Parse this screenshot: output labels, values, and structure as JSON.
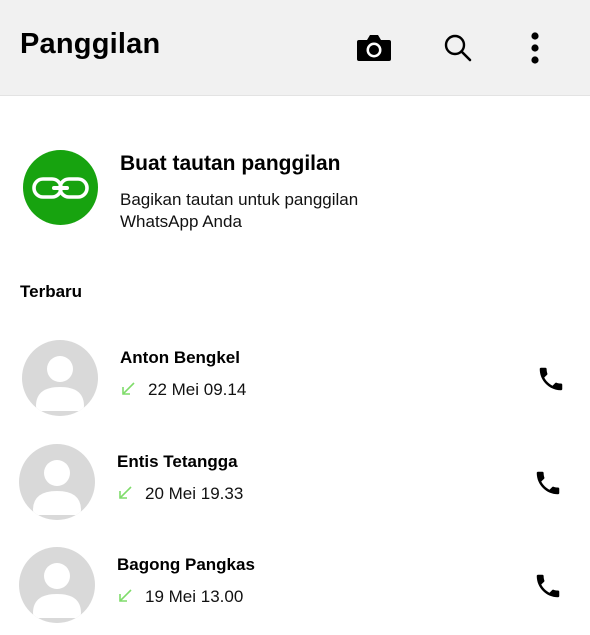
{
  "header": {
    "title": "Panggilan",
    "icons": [
      "camera-icon",
      "search-icon",
      "more-vert-icon"
    ]
  },
  "create_link": {
    "title": "Buat tautan panggilan",
    "description": "Bagikan tautan untuk panggilan WhatsApp Anda",
    "icon": "link-icon",
    "color": "#17a30f"
  },
  "recent": {
    "label": "Terbaru",
    "calls": [
      {
        "name": "Anton Bengkel",
        "time": "22 Mei 09.14",
        "direction": "incoming"
      },
      {
        "name": "Entis Tetangga",
        "time": "20 Mei 19.33",
        "direction": "incoming"
      },
      {
        "name": "Bagong Pangkas",
        "time": "19 Mei 13.00",
        "direction": "incoming"
      }
    ]
  },
  "colors": {
    "accent": "#17a30f",
    "incoming_arrow": "#7fdc6a",
    "header_bg": "#f1f1f1",
    "avatar_bg": "#d9d9d9"
  }
}
